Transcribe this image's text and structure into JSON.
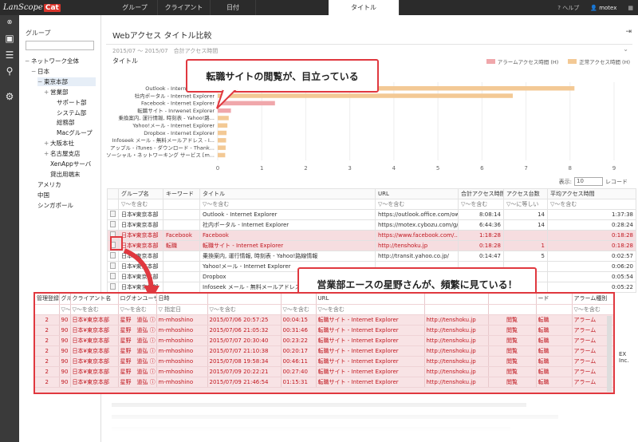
{
  "app": {
    "logo_text": "LanScope",
    "logo_badge": "Cat"
  },
  "top_tabs": [
    "グループ",
    "クライアント",
    "日付",
    "タイトル"
  ],
  "top_right": {
    "help": "ヘルプ",
    "user": "motex"
  },
  "tree": {
    "header": "グループ",
    "nodes": [
      {
        "label": "ネットワーク全体",
        "toggle": "−"
      },
      {
        "label": "日本",
        "toggle": "−"
      },
      {
        "label": "東京本部",
        "toggle": "−"
      },
      {
        "label": "営業部",
        "toggle": "+"
      },
      {
        "label": "サポート部",
        "toggle": ""
      },
      {
        "label": "システム部",
        "toggle": ""
      },
      {
        "label": "総務部",
        "toggle": ""
      },
      {
        "label": "Macグループ",
        "toggle": ""
      },
      {
        "label": "大阪本社",
        "toggle": "+"
      },
      {
        "label": "名古屋支店",
        "toggle": "+"
      },
      {
        "label": "XenAppサーバ",
        "toggle": ""
      },
      {
        "label": "貸出用端末",
        "toggle": ""
      },
      {
        "label": "アメリカ",
        "toggle": ""
      },
      {
        "label": "中国",
        "toggle": ""
      },
      {
        "label": "シンガポール",
        "toggle": ""
      }
    ]
  },
  "page": {
    "title": "Webアクセス タイトル比較",
    "period": "2015/07 ～ 2015/07　合計アクセス時間",
    "chart_title": "タイトル"
  },
  "colors": {
    "alarm": "#f0a7ab",
    "normal": "#f3c995",
    "accent": "#e0383f",
    "highlight": "#f6dde0"
  },
  "chart_data": {
    "type": "bar",
    "orientation": "horizontal",
    "stacked": true,
    "categories": [
      "Outlook - Internet Explorer",
      "社内ポータル - Internet Explorer",
      "Facebook - Internet Explorer",
      "転職サイト - Inrwenet Explorer",
      "乗換案内, 運行情報, 時刻表 - Yahoo!路...",
      "Yahoo!メール - Internet Explorer",
      "Dropbox - Internet Explorer",
      "Infoseek メール - 無料メールアドレス - I...",
      "アップル - iTunes - ダウンロード - Thank...",
      "ソーシャル・ネットワーキング サービス [m..."
    ],
    "series": [
      {
        "name": "アラームアクセス時間 (H)",
        "values": [
          0,
          0,
          1.3,
          0.3,
          0,
          0,
          0,
          0,
          0,
          0
        ]
      },
      {
        "name": "正常アクセス時間 (H)",
        "values": [
          8.1,
          6.7,
          0,
          0,
          0.25,
          0.22,
          0.2,
          0.19,
          0.18,
          0.17
        ]
      }
    ],
    "xlim": [
      0,
      9
    ],
    "xticks": [
      0,
      1,
      2,
      3,
      4,
      5,
      6,
      7,
      8,
      9
    ],
    "legend": "top-right"
  },
  "table_controls": {
    "label": "表示:",
    "page_size": "10",
    "unit": "レコード"
  },
  "table": {
    "columns": [
      "",
      "グループ名",
      "キーワード",
      "タイトル",
      "URL",
      "合計アクセス時間",
      "アクセス台数",
      "平均アクセス時間"
    ],
    "filters": [
      "",
      "▽～を含む",
      "",
      "▽～を含む",
      "▽～を含む",
      "▽～を含む",
      "▽～に等しい",
      "▽～を含む"
    ],
    "rows": [
      {
        "group": "日本¥東京本部",
        "keyword": "",
        "title": "Outlook - Internet Explorer",
        "url": "https://outlook.office.com/ow...",
        "total": "8:08:14",
        "count": "14",
        "avg": "1:37:38",
        "hl": false
      },
      {
        "group": "日本¥東京本部",
        "keyword": "",
        "title": "社内ポータル - Internet Explorer",
        "url": "https://motex.cybozu.com/g/...",
        "total": "6:44:36",
        "count": "14",
        "avg": "0:28:24",
        "hl": false
      },
      {
        "group": "日本¥東京本部",
        "keyword": "Facebook",
        "title": "Facebook",
        "url": "https://www.facebook.com/...",
        "total": "1:18:28",
        "count": "",
        "avg": "0:18:28",
        "hl": true
      },
      {
        "group": "日本¥東京本部",
        "keyword": "転職",
        "title": "転職サイト - Internet Explorer",
        "url": "http://tenshoku.jp",
        "total": "0:18:28",
        "count": "1",
        "avg": "0:18:28",
        "hl": true
      },
      {
        "group": "日本¥東京本部",
        "keyword": "",
        "title": "乗換案内, 運行情報, 時刻表 - Yahoo!路線情報",
        "url": "http://transit.yahoo.co.jp/",
        "total": "0:14:47",
        "count": "5",
        "avg": "0:02:57",
        "hl": false
      },
      {
        "group": "日本¥東京本部",
        "keyword": "",
        "title": "Yahoo!メール - Internet Explorer",
        "url": "",
        "total": "",
        "count": "",
        "avg": "0:06:20",
        "hl": false
      },
      {
        "group": "日本¥東京本部",
        "keyword": "",
        "title": "Dropbox",
        "url": "",
        "total": "",
        "count": "",
        "avg": "0:05:54",
        "hl": false
      },
      {
        "group": "日本¥東京本部",
        "keyword": "",
        "title": "Infoseek メール - 無料メールアドレス",
        "url": "",
        "total": "",
        "count": "",
        "avg": "0:05:22",
        "hl": false
      }
    ]
  },
  "callouts": {
    "top": "転職サイトの閲覧が、目立っている",
    "bottom": "営業部エースの星野さんが、頻繁に見ている！"
  },
  "detail": {
    "columns": [
      "管理登録...",
      "グループ名",
      "クライアント名",
      "ログオンユーザー名",
      "日時",
      "",
      "",
      "URL",
      "",
      "",
      "ード",
      "アラーム種別"
    ],
    "filters": [
      "",
      "▽～を含む",
      "▽～を含む",
      "▽～を含む",
      "▽ 指定日",
      "▽～を含む",
      "▽～を含む",
      "▽～を含む",
      "",
      "",
      "",
      "▽～を含む"
    ],
    "rows": [
      {
        "mgmt": "2",
        "id": "90",
        "group": "日本¥東京本部",
        "client": "星野　道弘",
        "user": "m-mhoshino",
        "date": "2015/07/06 20:57:25",
        "dur": "00:04:15",
        "title": "転職サイト - Internet Explorer",
        "url": "http://tenshoku.jp",
        "op": "閲覧",
        "kw": "転職",
        "alarm": "アラーム"
      },
      {
        "mgmt": "2",
        "id": "90",
        "group": "日本¥東京本部",
        "client": "星野　道弘",
        "user": "m-mhoshino",
        "date": "2015/07/06 21:05:32",
        "dur": "00:31:46",
        "title": "転職サイト - Internet Explorer",
        "url": "http://tenshoku.jp",
        "op": "閲覧",
        "kw": "転職",
        "alarm": "アラーム"
      },
      {
        "mgmt": "2",
        "id": "90",
        "group": "日本¥東京本部",
        "client": "星野　道弘",
        "user": "m-mhoshino",
        "date": "2015/07/07 20:30:40",
        "dur": "00:23:22",
        "title": "転職サイト - Internet Explorer",
        "url": "http://tenshoku.jp",
        "op": "閲覧",
        "kw": "転職",
        "alarm": "アラーム"
      },
      {
        "mgmt": "2",
        "id": "90",
        "group": "日本¥東京本部",
        "client": "星野　道弘",
        "user": "m-mhoshino",
        "date": "2015/07/07 21:10:38",
        "dur": "00:20:17",
        "title": "転職サイト - Internet Explorer",
        "url": "http://tenshoku.jp",
        "op": "閲覧",
        "kw": "転職",
        "alarm": "アラーム"
      },
      {
        "mgmt": "2",
        "id": "90",
        "group": "日本¥東京本部",
        "client": "星野　道弘",
        "user": "m-mhoshino",
        "date": "2015/07/08 19:58:34",
        "dur": "00:46:11",
        "title": "転職サイト - Internet Explorer",
        "url": "http://tenshoku.jp",
        "op": "閲覧",
        "kw": "転職",
        "alarm": "アラーム"
      },
      {
        "mgmt": "2",
        "id": "90",
        "group": "日本¥東京本部",
        "client": "星野　道弘",
        "user": "m-mhoshino",
        "date": "2015/07/09 20:22:21",
        "dur": "00:27:40",
        "title": "転職サイト - Internet Explorer",
        "url": "http://tenshoku.jp",
        "op": "閲覧",
        "kw": "転職",
        "alarm": "アラーム"
      },
      {
        "mgmt": "2",
        "id": "90",
        "group": "日本¥東京本部",
        "client": "星野　道弘",
        "user": "m-mhoshino",
        "date": "2015/07/09 21:46:54",
        "dur": "01:15:31",
        "title": "転職サイト - Internet Explorer",
        "url": "http://tenshoku.jp",
        "op": "閲覧",
        "kw": "転職",
        "alarm": "アラーム"
      }
    ]
  },
  "footer_fragment": "EX Inc."
}
